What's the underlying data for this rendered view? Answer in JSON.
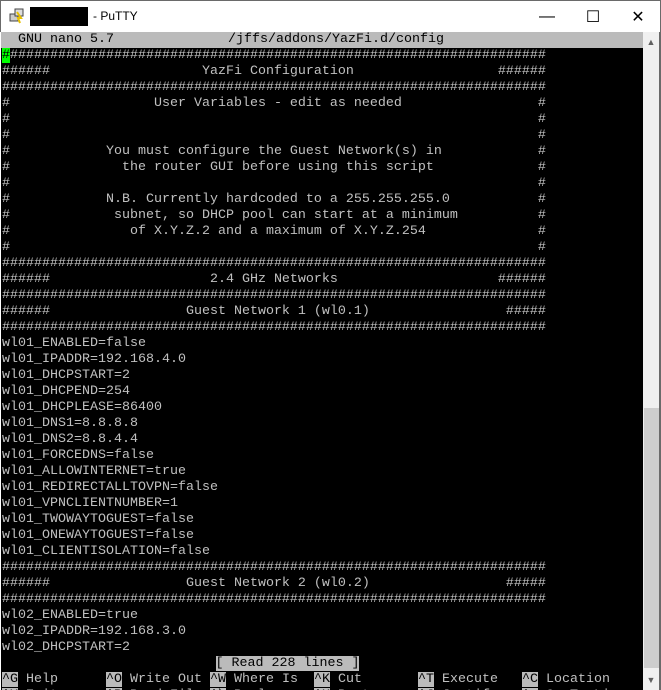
{
  "window": {
    "title": "- PuTTY",
    "icon": "putty-icon"
  },
  "nano": {
    "version": "GNU nano 5.7",
    "filename": "/jffs/addons/YazFi.d/config",
    "lines": [
      "####################################################################",
      "######                   YazFi Configuration                  ######",
      "####################################################################",
      "#                  User Variables - edit as needed                 #",
      "#                                                                  #",
      "#                                                                  #",
      "#            You must configure the Guest Network(s) in            #",
      "#              the router GUI before using this script             #",
      "#                                                                  #",
      "#            N.B. Currently hardcoded to a 255.255.255.0           #",
      "#             subnet, so DHCP pool can start at a minimum          #",
      "#               of X.Y.Z.2 and a maximum of X.Y.Z.254              #",
      "#                                                                  #",
      "####################################################################",
      "######                    2.4 GHz Networks                    ######",
      "####################################################################",
      "######                 Guest Network 1 (wl0.1)                 #####",
      "####################################################################",
      "wl01_ENABLED=false",
      "wl01_IPADDR=192.168.4.0",
      "wl01_DHCPSTART=2",
      "wl01_DHCPEND=254",
      "wl01_DHCPLEASE=86400",
      "wl01_DNS1=8.8.8.8",
      "wl01_DNS2=8.8.4.4",
      "wl01_FORCEDNS=false",
      "wl01_ALLOWINTERNET=true",
      "wl01_REDIRECTALLTOVPN=false",
      "wl01_VPNCLIENTNUMBER=1",
      "wl01_TWOWAYTOGUEST=false",
      "wl01_ONEWAYTOGUEST=false",
      "wl01_CLIENTISOLATION=false",
      "####################################################################",
      "######                 Guest Network 2 (wl0.2)                 #####",
      "####################################################################",
      "wl02_ENABLED=true",
      "wl02_IPADDR=192.168.3.0",
      "wl02_DHCPSTART=2"
    ],
    "status": "[ Read 228 lines ]",
    "shortcuts": [
      [
        {
          "key": "^G",
          "label": "Help"
        },
        {
          "key": "^O",
          "label": "Write Out"
        },
        {
          "key": "^W",
          "label": "Where Is"
        },
        {
          "key": "^K",
          "label": "Cut"
        },
        {
          "key": "^T",
          "label": "Execute"
        },
        {
          "key": "^C",
          "label": "Location"
        }
      ],
      [
        {
          "key": "^X",
          "label": "Exit"
        },
        {
          "key": "^R",
          "label": "Read File"
        },
        {
          "key": "^\\",
          "label": "Replace"
        },
        {
          "key": "^U",
          "label": "Paste"
        },
        {
          "key": "^J",
          "label": "Justify"
        },
        {
          "key": "^_",
          "label": "Go To Line"
        }
      ]
    ]
  },
  "colors": {
    "cursor": "#00ff00",
    "terminal_bg": "#000000",
    "terminal_fg": "#c0c0c0",
    "bar_bg": "#bbbbbb"
  }
}
